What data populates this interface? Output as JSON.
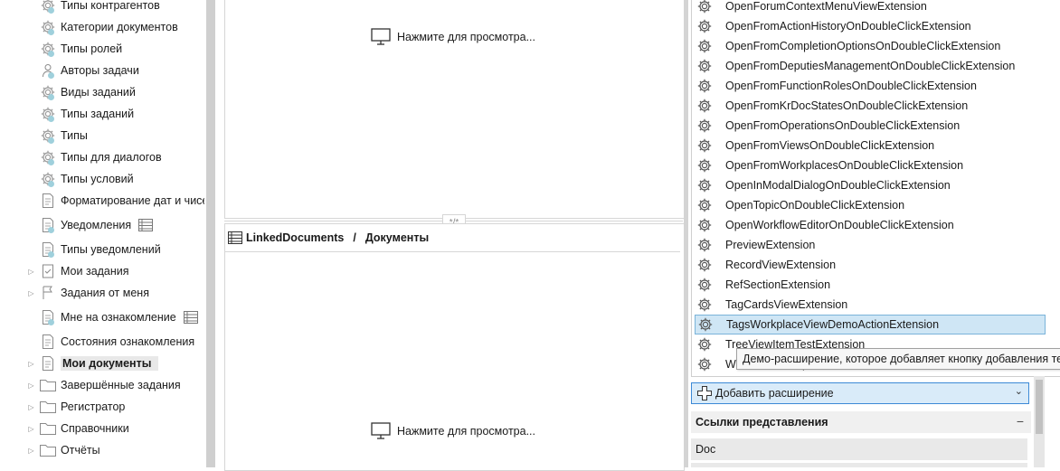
{
  "tree": {
    "items": [
      {
        "label": "Типы контрагентов",
        "icon": "gear-icon",
        "expander": false
      },
      {
        "label": "Категории документов",
        "icon": "gear-icon",
        "expander": false
      },
      {
        "label": "Типы ролей",
        "icon": "gear-icon",
        "expander": false
      },
      {
        "label": "Авторы задачи",
        "icon": "person-icon",
        "expander": false
      },
      {
        "label": "Виды заданий",
        "icon": "gear-icon",
        "expander": false
      },
      {
        "label": "Типы заданий",
        "icon": "gear-icon",
        "expander": false
      },
      {
        "label": "Типы",
        "icon": "gear-icon",
        "expander": false
      },
      {
        "label": "Типы для диалогов",
        "icon": "gear-icon",
        "expander": false
      },
      {
        "label": "Типы условий",
        "icon": "gear-icon",
        "expander": false
      },
      {
        "label": "Форматирование дат и чисе",
        "icon": "document-icon",
        "expander": false
      },
      {
        "label": "Уведомления",
        "icon": "document-icon",
        "expander": false,
        "badge": "table-icon"
      },
      {
        "label": "Типы уведомлений",
        "icon": "document-icon",
        "expander": false
      },
      {
        "label": "Мои задания",
        "icon": "checklist-icon",
        "expander": true
      },
      {
        "label": "Задания от меня",
        "icon": "flag-icon",
        "expander": true
      },
      {
        "label": "Мне на ознакомление",
        "icon": "document-icon",
        "expander": false,
        "badge": "table-icon"
      },
      {
        "label": "Состояния ознакомления",
        "icon": "document-icon",
        "expander": false
      },
      {
        "label": "Мои документы",
        "icon": "document-icon",
        "expander": true,
        "selected": true
      },
      {
        "label": "Завершённые задания",
        "icon": "folder-icon",
        "expander": true
      },
      {
        "label": "Регистратор",
        "icon": "folder-icon",
        "expander": true
      },
      {
        "label": "Справочники",
        "icon": "folder-icon",
        "expander": true
      },
      {
        "label": "Отчёты",
        "icon": "folder-icon",
        "expander": true
      }
    ]
  },
  "center": {
    "top_preview_label": "Нажмите для просмотра...",
    "splitter_glyph": "*/*",
    "breadcrumb_first": "LinkedDocuments",
    "breadcrumb_separator": "/",
    "breadcrumb_second": "Документы",
    "bottom_preview_label": "Нажмите для просмотра..."
  },
  "extensions": {
    "items": [
      "OpenForumContextMenuViewExtension",
      "OpenFromActionHistoryOnDoubleClickExtension",
      "OpenFromCompletionOptionsOnDoubleClickExtension",
      "OpenFromDeputiesManagementOnDoubleClickExtension",
      "OpenFromFunctionRolesOnDoubleClickExtension",
      "OpenFromKrDocStatesOnDoubleClickExtension",
      "OpenFromOperationsOnDoubleClickExtension",
      "OpenFromViewsOnDoubleClickExtension",
      "OpenFromWorkplacesOnDoubleClickExtension",
      "OpenInModalDialogOnDoubleClickExtension",
      "OpenTopicOnDoubleClickExtension",
      "OpenWorkflowEditorOnDoubleClickExtension",
      "PreviewExtension",
      "RecordViewExtension",
      "RefSectionExtension",
      "TagCardsViewExtension",
      "TagsWorkplaceViewDemoActionExtension",
      "TreeViewItemTestExtension",
      "WebChartWorkplaceExtension"
    ],
    "selected_index": 16,
    "tooltip": "Демо-расширение, которое добавляет кнопку добавления тега в",
    "add_button_label": "Добавить расширение",
    "section_title": "Ссылки представления",
    "section_collapse": "−",
    "links": [
      "Doc"
    ]
  },
  "colors": {
    "selection_bg": "#cfe6f5",
    "selection_border": "#7ab3d9",
    "button_border": "#3c8ad6",
    "button_bg": "#d9ebf9"
  }
}
